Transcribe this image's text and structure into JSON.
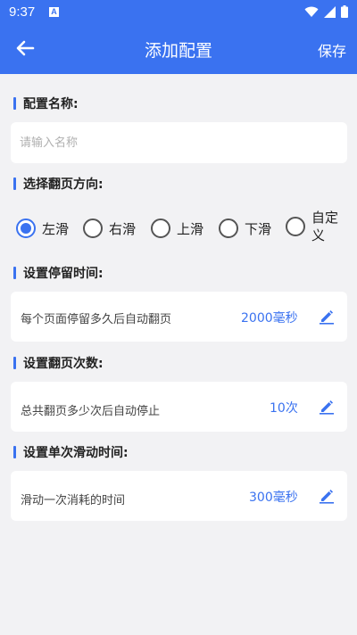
{
  "status_bar": {
    "time": "9:37",
    "notif_letter": "A"
  },
  "header": {
    "title": "添加配置",
    "save_label": "保存"
  },
  "config_name": {
    "label": "配置名称:",
    "placeholder": "请输入名称",
    "value": ""
  },
  "direction": {
    "label": "选择翻页方向:",
    "options": [
      "左滑",
      "右滑",
      "上滑",
      "下滑",
      "自定义"
    ],
    "selected": "左滑"
  },
  "dwell_time": {
    "label": "设置停留时间:",
    "description": "每个页面停留多久后自动翻页",
    "value": "2000毫秒"
  },
  "page_count": {
    "label": "设置翻页次数:",
    "description": "总共翻页多少次后自动停止",
    "value": "10次"
  },
  "swipe_time": {
    "label": "设置单次滑动时间:",
    "description": "滑动一次消耗的时间",
    "value": "300毫秒"
  },
  "colors": {
    "accent": "#3a72f0",
    "background": "#f2f2f4",
    "card": "#ffffff"
  }
}
